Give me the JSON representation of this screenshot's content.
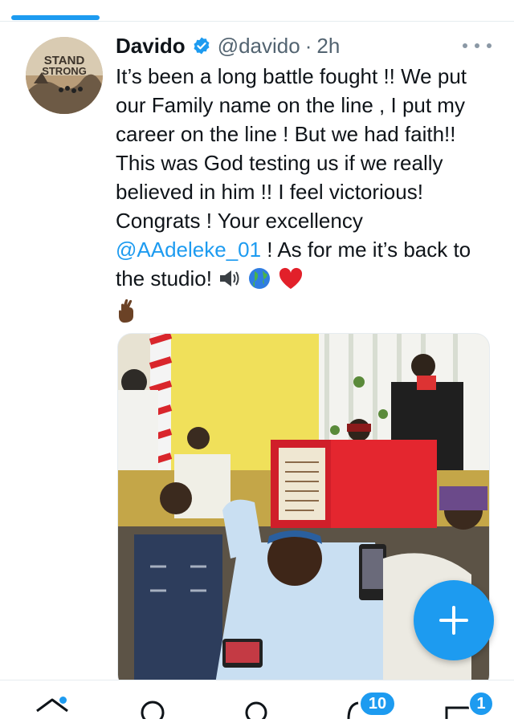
{
  "tweet": {
    "author_name": "Davido",
    "handle": "@davido",
    "separator": "·",
    "time": "2h",
    "avatar_text_line1": "STAND",
    "avatar_text_line2": "STRONG",
    "text_part1": "It’s been a long battle fought !! We put our Family name on the line , I put my career on the line ! But we had faith!! This was God testing us if we really believed in him !! I feel victorious! Congrats ! Your excellency ",
    "mention": "@AAdeleke_01",
    "text_part2": " ! As for me it’s back to the studio! ",
    "emoji_icons": [
      "speaker-icon",
      "globe-icon",
      "red-heart-icon",
      "crossed-fingers-icon"
    ]
  },
  "compose": {
    "icon": "plus-icon"
  },
  "bottom_nav": {
    "items": [
      "home-icon",
      "search-icon",
      "spaces-icon",
      "notifications-icon",
      "messages-icon"
    ],
    "notifications_badge": "10",
    "messages_badge": "1"
  },
  "colors": {
    "accent": "#1d9bf0",
    "text": "#0f1419",
    "secondary": "#536471"
  }
}
